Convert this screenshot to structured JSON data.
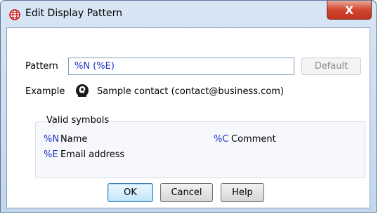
{
  "window": {
    "title": "Edit Display Pattern",
    "close_glyph": "X",
    "app_icon": "globe-grid-icon"
  },
  "pattern": {
    "label": "Pattern",
    "value": "%N (%E)",
    "default_button": "Default"
  },
  "example": {
    "label": "Example",
    "icon": "contact-person-icon",
    "text": "Sample contact (contact@business.com)"
  },
  "symbols": {
    "title": "Valid symbols",
    "items": [
      {
        "code": "%N",
        "desc": "Name"
      },
      {
        "code": "%C",
        "desc": "Comment"
      },
      {
        "code": "%E",
        "desc": "Email address"
      }
    ]
  },
  "buttons": {
    "ok": "OK",
    "cancel": "Cancel",
    "help": "Help"
  },
  "colors": {
    "symbol_code": "#1a33cc",
    "close_button": "#c13420",
    "app_icon": "#c8161d"
  }
}
